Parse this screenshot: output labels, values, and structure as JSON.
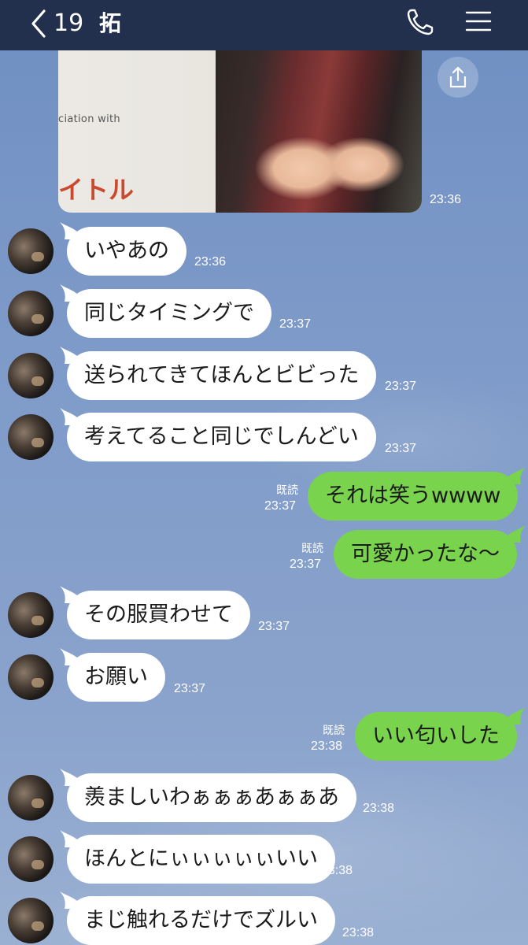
{
  "header": {
    "unread_count": "19",
    "title": "拓"
  },
  "photo_message": {
    "caption": "ciation with",
    "logo_text": "イトル",
    "time": "23:36"
  },
  "messages": [
    {
      "side": "in",
      "text": "いやあの",
      "time": "23:36"
    },
    {
      "side": "in",
      "text": "同じタイミングで",
      "time": "23:37"
    },
    {
      "side": "in",
      "text": "送られてきてほんとビビった",
      "time": "23:37"
    },
    {
      "side": "in",
      "text": "考えてること同じでしんどい",
      "time": "23:37"
    },
    {
      "side": "out",
      "text": "それは笑うwwww",
      "time": "23:37",
      "read": "既読"
    },
    {
      "side": "out",
      "text": "可愛かったな〜",
      "time": "23:37",
      "read": "既読"
    },
    {
      "side": "in",
      "text": "その服買わせて",
      "time": "23:37"
    },
    {
      "side": "in",
      "text": "お願い",
      "time": "23:37"
    },
    {
      "side": "out",
      "text": "いい匂いした",
      "time": "23:38",
      "read": "既読"
    },
    {
      "side": "in",
      "text": "羨ましいわぁぁぁあぁぁあ",
      "time": "23:38"
    },
    {
      "side": "in",
      "text": "ほんとにぃぃぃぃぃいい",
      "time": "23:38"
    },
    {
      "side": "in",
      "text": "まじ触れるだけでズルい",
      "time": "23:38"
    }
  ],
  "colors": {
    "header": "#23304d",
    "background": "#7d99c6",
    "bubble_in": "#ffffff",
    "bubble_out": "#79d34d"
  },
  "icons": {
    "back": "chevron-left-icon",
    "call": "phone-icon",
    "menu": "menu-icon",
    "share": "share-icon"
  }
}
